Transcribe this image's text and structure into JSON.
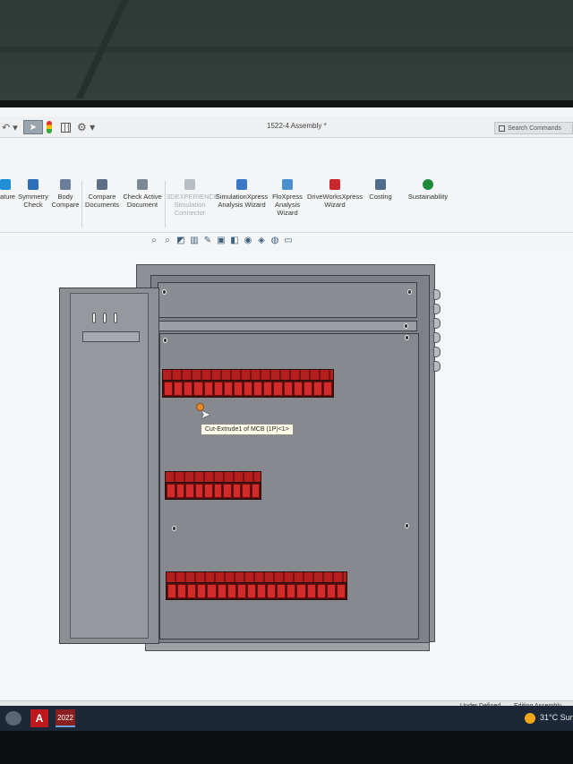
{
  "quick_access": {
    "selection_icon": "arrow-pointer-icon"
  },
  "window": {
    "title": "1522-4 Assembly *"
  },
  "search": {
    "placeholder": "Search Commands"
  },
  "ribbon": {
    "items": [
      {
        "label": "ature",
        "icon": "feature-icon",
        "color": "#1f8fd8"
      },
      {
        "label": "Symmetry Check",
        "icon": "symmetry-icon",
        "color": "#2a6fb8"
      },
      {
        "label": "Body Compare",
        "icon": "body-compare-icon",
        "color": "#6a7f99"
      },
      {
        "label": "Compare Documents",
        "icon": "compare-docs-icon",
        "color": "#5c6f86"
      },
      {
        "label": "Check Active Document",
        "icon": "check-doc-icon",
        "color": "#7d8894"
      },
      {
        "label": "3DEXPERIENCE Simulation Connector",
        "icon": "simulation-connector-icon",
        "color": "#b9bec4",
        "disabled": true
      },
      {
        "label": "SimulationXpress Analysis Wizard",
        "icon": "simxpress-icon",
        "color": "#3a79c5"
      },
      {
        "label": "FloXpress Analysis Wizard",
        "icon": "floxpress-icon",
        "color": "#4b8fcf"
      },
      {
        "label": "DriveWorksXpress Wizard",
        "icon": "driveworks-icon",
        "color": "#c8272b"
      },
      {
        "label": "Costing",
        "icon": "costing-icon",
        "color": "#4f6c8c"
      },
      {
        "label": "Sustainability",
        "icon": "sustainability-icon",
        "color": "#1c8a3a"
      }
    ]
  },
  "viewbar": {
    "icons": [
      "zoom-fit-icon",
      "zoom-area-icon",
      "previous-view-icon",
      "section-view-icon",
      "dynamic-annotation-icon",
      "view-orientation-icon",
      "display-style-icon",
      "hide-show-icon",
      "edit-appearance-icon",
      "apply-scene-icon",
      "view-settings-icon"
    ]
  },
  "graphics": {
    "tooltip": "Cut-Extrude1 of MCB (1P)<1>",
    "mcb_rows": [
      {
        "modules": 17
      },
      {
        "modules": 10
      },
      {
        "modules": 18
      }
    ]
  },
  "status": {
    "state1": "Under Defined",
    "state2": "Editing Assembly"
  },
  "taskbar": {
    "app1": "A",
    "app2": "2022",
    "weather_temp": "31°C",
    "weather_text": "Sunny"
  }
}
